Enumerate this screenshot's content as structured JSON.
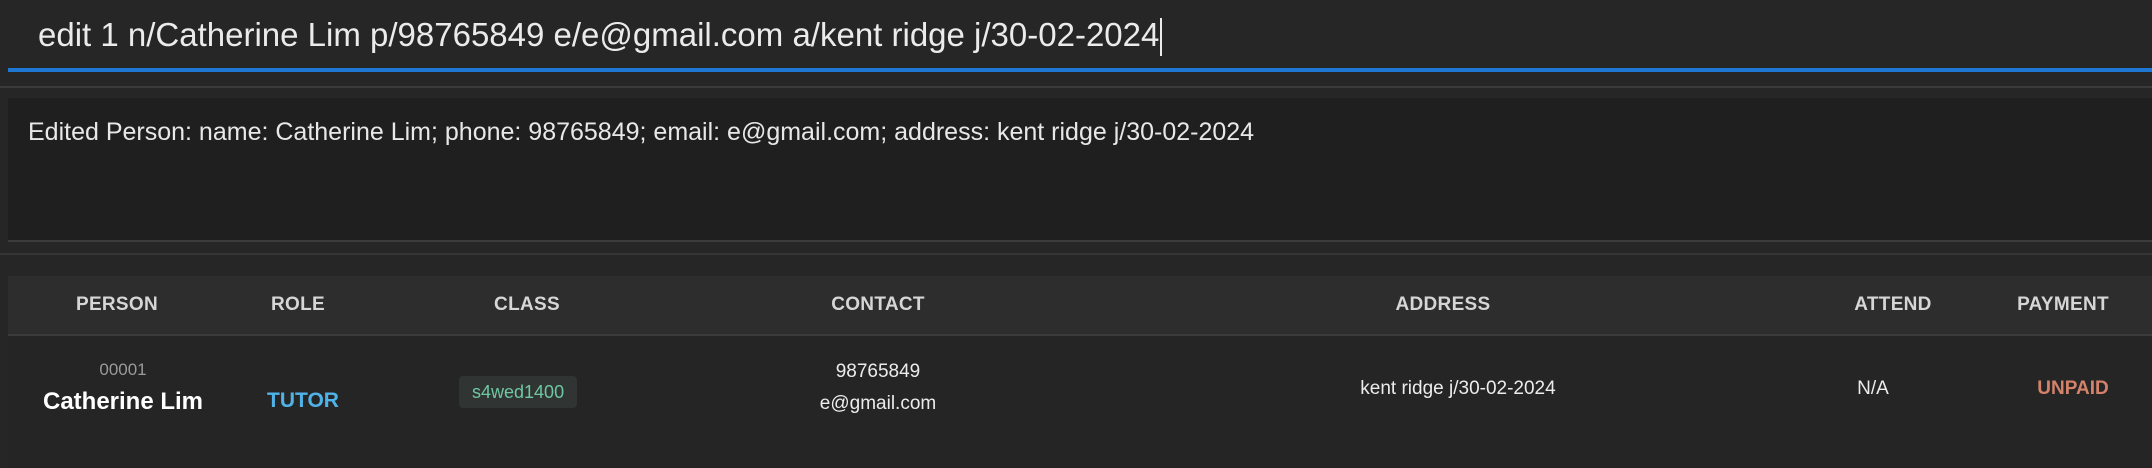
{
  "command": {
    "input_value": "edit 1 n/Catherine Lim p/98765849 e/e@gmail.com a/kent ridge j/30-02-2024"
  },
  "result": {
    "message": "Edited Person: name: Catherine Lim; phone: 98765849; email: e@gmail.com; address: kent ridge j/30-02-2024"
  },
  "table": {
    "headers": {
      "person": "PERSON",
      "role": "ROLE",
      "class": "CLASS",
      "contact": "CONTACT",
      "address": "ADDRESS",
      "attend": "ATTEND",
      "payment": "PAYMENT"
    },
    "rows": [
      {
        "id": "00001",
        "name": "Catherine Lim",
        "role": "TUTOR",
        "class": "s4wed1400",
        "phone": "98765849",
        "email": "e@gmail.com",
        "address": "kent ridge j/30-02-2024",
        "attend": "N/A",
        "payment": "UNPAID"
      }
    ]
  },
  "colors": {
    "accent": "#1e77d3",
    "role": "#4fb3e8",
    "class_tag": "#6fc7a4",
    "payment_unpaid": "#d4836a"
  }
}
